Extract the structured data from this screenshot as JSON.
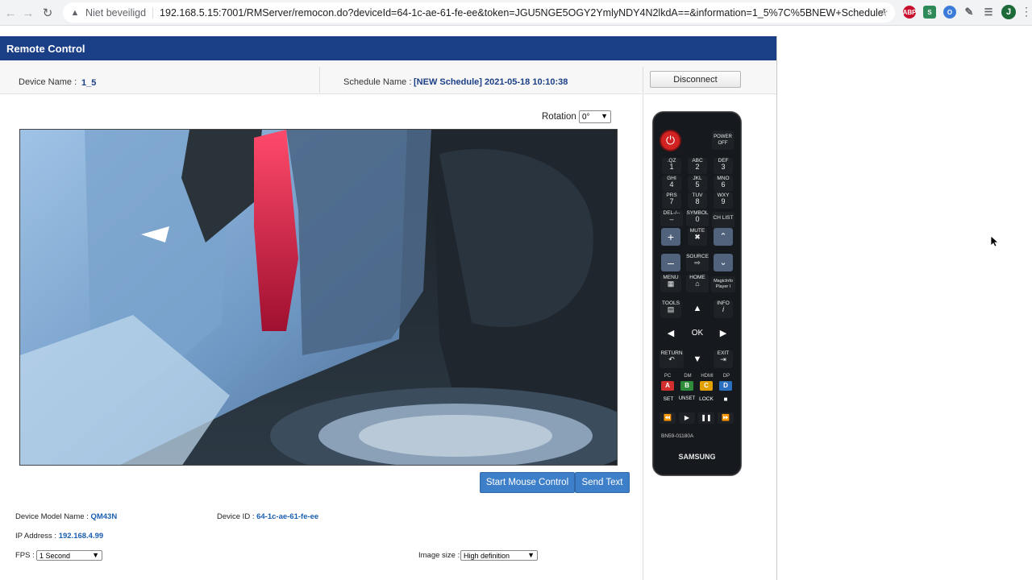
{
  "browser": {
    "security_label": "Niet beveiligd",
    "url": "192.168.5.15:7001/RMServer/remocon.do?deviceId=64-1c-ae-61-fe-ee&token=JGU5NGE5OGY2YmlyNDY4N2lkdA==&information=1_5%7C%5BNEW+Schedule%5D+2021-0...",
    "extensions": [
      "ABP",
      "S",
      "O"
    ],
    "avatar_letter": "J"
  },
  "app": {
    "title": "Remote Control",
    "device_name_label": "Device Name :",
    "device_name": "1_5",
    "schedule_name_label": "Schedule Name :",
    "schedule_name": "[NEW Schedule] 2021-05-18 10:10:38",
    "disconnect_label": "Disconnect",
    "rotation_label": "Rotation",
    "rotation_value": "0°",
    "start_mouse_label": "Start Mouse Control",
    "send_text_label": "Send Text",
    "device_model_label": "Device Model Name :",
    "device_model": "QM43N",
    "device_id_label": "Device ID :",
    "device_id": "64-1c-ae-61-fe-ee",
    "ip_label": "IP Address :",
    "ip": "192.168.4.99",
    "fps_label": "FPS :",
    "fps_value": "1 Second",
    "image_size_label": "Image size :",
    "image_size_value": "High definition"
  },
  "remote": {
    "power_off": "POWER OFF",
    "numpad": [
      {
        "top": ".QZ",
        "num": "1"
      },
      {
        "top": "ABC",
        "num": "2"
      },
      {
        "top": "DEF",
        "num": "3"
      },
      {
        "top": "GHI",
        "num": "4"
      },
      {
        "top": "JKL",
        "num": "5"
      },
      {
        "top": "MNO",
        "num": "6"
      },
      {
        "top": "PRS",
        "num": "7"
      },
      {
        "top": "TUV",
        "num": "8"
      },
      {
        "top": "WXY",
        "num": "9"
      }
    ],
    "del": "DEL-/--",
    "symbol": "SYMBOL",
    "zero": "0",
    "ch_list": "CH LIST",
    "mute": "MUTE",
    "source": "SOURCE",
    "menu": "MENU",
    "home": "HOME",
    "magicinfo": "MagicInfo Player I",
    "tools": "TOOLS",
    "info": "INFO",
    "ok": "OK",
    "return": "RETURN",
    "exit": "EXIT",
    "color_labels": [
      "PC",
      "DM",
      "HDMI",
      "DP"
    ],
    "color_keys": [
      {
        "letter": "A",
        "color": "#d32f2f"
      },
      {
        "letter": "B",
        "color": "#2e8b3a"
      },
      {
        "letter": "C",
        "color": "#e0a000"
      },
      {
        "letter": "D",
        "color": "#2a6fc0"
      }
    ],
    "set": "SET",
    "unset": "UNSET",
    "lock": "LOCK",
    "model_code": "BN59-01180A",
    "brand": "SAMSUNG"
  }
}
